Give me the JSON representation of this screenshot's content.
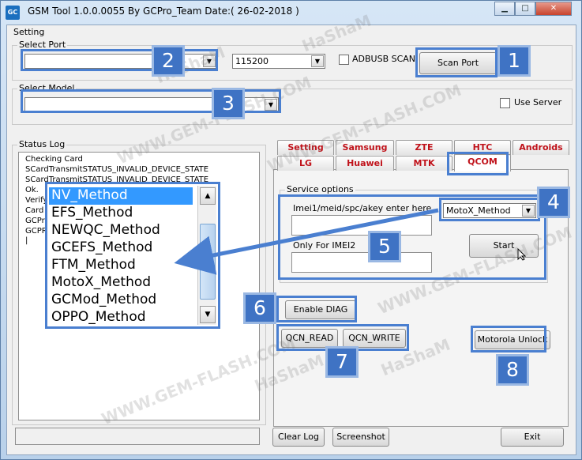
{
  "window": {
    "title": "GSM Tool 1.0.0.0055 By GCPro_Team  Date:( 26-02-2018 )",
    "icon": "GC"
  },
  "menu": {
    "setting": "Setting"
  },
  "port": {
    "group_label": "Select Port",
    "port_value": "",
    "baud_value": "115200",
    "adbusb_label": "ADBUSB SCAN",
    "adbusb_checked": false,
    "scan_button": "Scan Port"
  },
  "model": {
    "group_label": "Select Model",
    "value": "",
    "use_server_label": "Use Server",
    "use_server_checked": false
  },
  "status_log": {
    "label": "Status Log",
    "lines": [
      "Checking Card",
      "SCardTransmitSTATUS_INVALID_DEVICE_STATE",
      "SCardTransmitSTATUS_INVALID_DEVICE_STATE",
      "Ok.",
      "Verify",
      "Card O",
      "GCPro",
      "GCPRO"
    ]
  },
  "tabs": {
    "row1": [
      "Setting",
      "Samsung",
      "ZTE",
      "HTC",
      "Androids"
    ],
    "row2": [
      "LG",
      "Huawei",
      "MTK",
      "QCOM"
    ],
    "active": "QCOM"
  },
  "service": {
    "group_label": "Service options",
    "imei1_label": "Imei1/meid/spc/akey enter here",
    "imei2_label": "Only For IMEI2",
    "method_value": "MotoX_Method",
    "start_button": "Start"
  },
  "method_list": [
    "NV_Method",
    "EFS_Method",
    "NEWQC_Method",
    "GCEFS_Method",
    "FTM_Method",
    "MotoX_Method",
    "GCMod_Method",
    "OPPO_Method"
  ],
  "buttons": {
    "enable_diag": "Enable DIAG",
    "qcn_read": "QCN_READ",
    "qcn_write": "QCN_WRITE",
    "motorola_unlock": "Motorola Unlock",
    "clear_log": "Clear Log",
    "screenshot": "Screenshot",
    "exit": "Exit"
  },
  "callouts": [
    "1",
    "2",
    "3",
    "4",
    "5",
    "6",
    "7",
    "8"
  ],
  "watermarks": [
    "HaShaM",
    "WWW.GEM-FLASH.COM"
  ],
  "colors": {
    "accent": "#3f73c4",
    "tab_text": "#c0121a",
    "selection": "#3399ff"
  }
}
